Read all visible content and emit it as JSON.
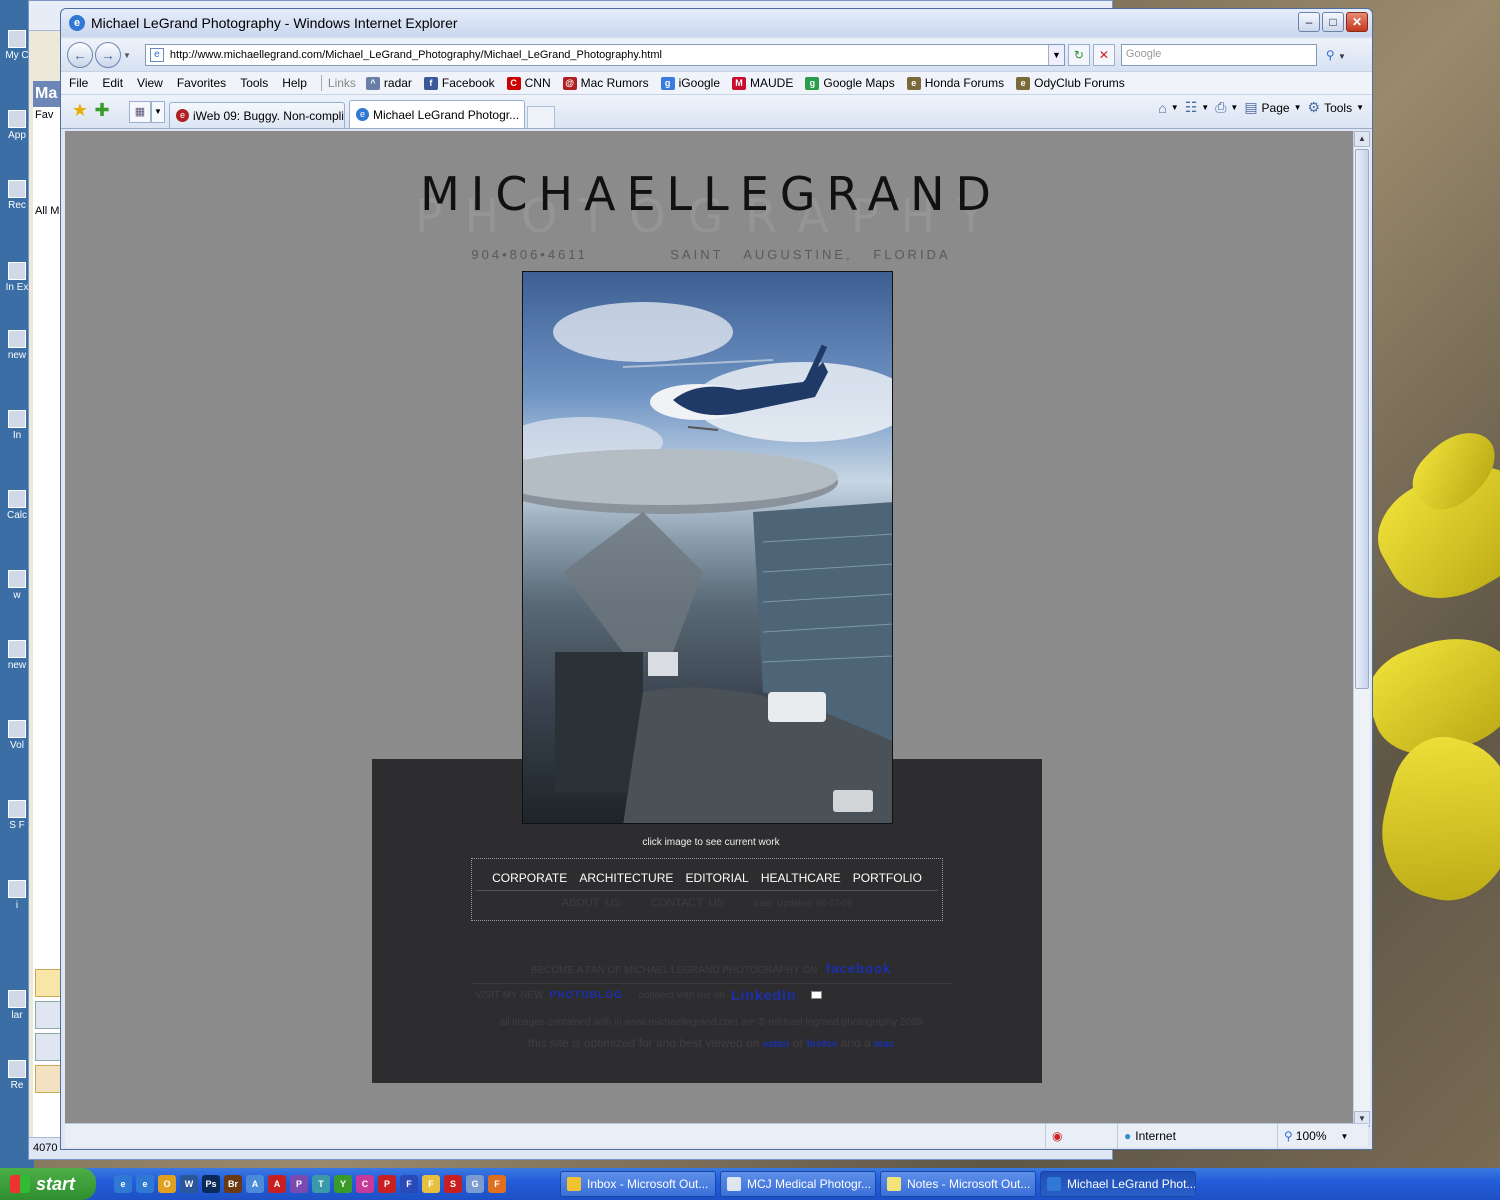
{
  "desktop": {
    "icons": [
      "My C",
      "App",
      "Rec",
      "In Ex",
      "new",
      "In",
      "Calc",
      "w",
      "new",
      "Vol",
      "S F",
      "i",
      "lar",
      "Re"
    ]
  },
  "outlook_bg": {
    "side_label": "Ma",
    "fav_label": "Fav",
    "all_label": "All M",
    "status": "4070"
  },
  "ie": {
    "window_title": "Michael LeGrand Photography - Windows Internet Explorer",
    "address": "http://www.michaellegrand.com/Michael_LeGrand_Photography/Michael_LeGrand_Photography.html",
    "search_placeholder": "Google",
    "menu": [
      "File",
      "Edit",
      "View",
      "Favorites",
      "Tools",
      "Help"
    ],
    "links_label": "Links",
    "links": [
      {
        "label": "radar",
        "color": "#6a7fa8",
        "glyph": "^"
      },
      {
        "label": "Facebook",
        "color": "#3b5998",
        "glyph": "f"
      },
      {
        "label": "CNN",
        "color": "#cc0000",
        "glyph": "C"
      },
      {
        "label": "Mac Rumors",
        "color": "#b02020",
        "glyph": "@"
      },
      {
        "label": "iGoogle",
        "color": "#3a7be0",
        "glyph": "g"
      },
      {
        "label": "MAUDE",
        "color": "#c8102e",
        "glyph": "M"
      },
      {
        "label": "Google Maps",
        "color": "#2a9d4a",
        "glyph": "g"
      },
      {
        "label": "Honda Forums",
        "color": "#7a6a3a",
        "glyph": "e"
      },
      {
        "label": "OdyClub Forums",
        "color": "#7a6a3a",
        "glyph": "e"
      }
    ],
    "tabs": [
      {
        "label": "iWeb 09: Buggy. Non-compli...",
        "color": "#b02020",
        "active": false
      },
      {
        "label": "Michael LeGrand Photogr...",
        "color": "#2f78d4",
        "active": true
      }
    ],
    "cmd": {
      "page": "Page",
      "tools": "Tools"
    },
    "status": {
      "zone": "Internet",
      "zoom": "100%"
    }
  },
  "site": {
    "title": "MICHAELLEGRAND",
    "subtitle": "PHOTOGRAPHY",
    "phone": "904•806•4611",
    "location": "SAINT AUGUSTINE, FLORIDA",
    "caption": "click image to see current work",
    "nav": [
      "CORPORATE",
      "ARCHITECTURE",
      "EDITORIAL",
      "HEALTHCARE",
      "PORTFOLIO"
    ],
    "subnav": [
      "ABOUT US",
      "CONTACT US"
    ],
    "updated": "Last Updated 06-07-09",
    "fan_text": "BECOME A FAN OF MICHAEL LEGRAND PHOTOGRAPHY ON",
    "fan_brand": "facebook",
    "photoblog_text": "VISIT MY NEW",
    "photoblog": "PHOTOBLOG",
    "connect_text": "connect with me on",
    "linkedin": "LinkedIn",
    "copyright": "all images contained with in www.michaellegrand.com are © michael legrand photography 2009",
    "optimized_text": "this site is optimized for and best viewed on",
    "browsers": [
      "safari",
      "firefox",
      "mac"
    ],
    "or": "or",
    "and_a": "and a"
  },
  "taskbar": {
    "start": "start",
    "tasks": [
      {
        "label": "Inbox - Microsoft Out...",
        "color": "#f1c232"
      },
      {
        "label": "MCJ Medical Photogr...",
        "color": "#dfe6f2"
      },
      {
        "label": "Notes - Microsoft Out...",
        "color": "#f3e47a"
      },
      {
        "label": "Michael LeGrand Phot...",
        "color": "#2f78d4"
      }
    ],
    "quick_icons": [
      {
        "name": "ie-quick",
        "color": "#2f78d4",
        "glyph": "e"
      },
      {
        "name": "ie2-quick",
        "color": "#2f78d4",
        "glyph": "e"
      },
      {
        "name": "outlook-quick",
        "color": "#e0a020",
        "glyph": "O"
      },
      {
        "name": "word-quick",
        "color": "#2b579a",
        "glyph": "W"
      },
      {
        "name": "photoshop-quick",
        "color": "#0a2a5a",
        "glyph": "Ps"
      },
      {
        "name": "bridge-quick",
        "color": "#6a3a14",
        "glyph": "Br"
      },
      {
        "name": "browser-quick",
        "color": "#4a8ad8",
        "glyph": "A"
      },
      {
        "name": "acrobat-quick",
        "color": "#c82020",
        "glyph": "A"
      },
      {
        "name": "picasa-quick",
        "color": "#7a4ab0",
        "glyph": "P"
      },
      {
        "name": "tool-quick",
        "color": "#3a9aaa",
        "glyph": "T"
      },
      {
        "name": "tree-quick",
        "color": "#3a9a2a",
        "glyph": "Y"
      },
      {
        "name": "colors-quick",
        "color": "#c83a9a",
        "glyph": "C"
      },
      {
        "name": "pdf-quick",
        "color": "#c82020",
        "glyph": "P"
      },
      {
        "name": "flag-quick",
        "color": "#2a4ab8",
        "glyph": "F"
      },
      {
        "name": "folder-quick",
        "color": "#e8c040",
        "glyph": "F"
      },
      {
        "name": "stop-quick",
        "color": "#c82020",
        "glyph": "S"
      },
      {
        "name": "globe-quick",
        "color": "#7a9ad0",
        "glyph": "G"
      },
      {
        "name": "firefox-quick",
        "color": "#e07020",
        "glyph": "F"
      }
    ]
  }
}
